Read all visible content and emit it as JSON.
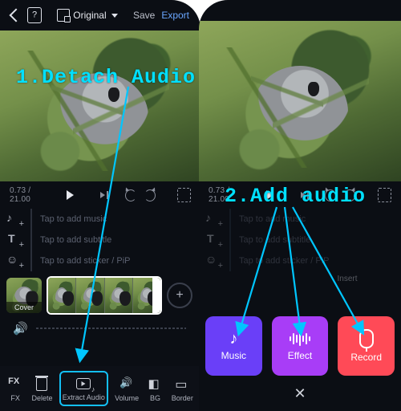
{
  "annotations": {
    "step1": "1.Detach Audio",
    "step2": "2.Add audio"
  },
  "toolbar": {
    "aspect_label": "Original",
    "save_label": "Save",
    "export_label": "Export"
  },
  "playback": {
    "time_display": "0.73 / 21.00"
  },
  "tracks": {
    "music_hint": "Tap to add music",
    "subtitle_hint": "Tap to add subtitle",
    "sticker_hint": "Tap to add sticker / PiP",
    "insert_label": "Insert"
  },
  "cover": {
    "label": "Cover"
  },
  "bottom_bar": {
    "items": [
      {
        "id": "fx",
        "label": "FX"
      },
      {
        "id": "delete",
        "label": "Delete"
      },
      {
        "id": "extract",
        "label": "Extract Audio"
      },
      {
        "id": "volume",
        "label": "Volume"
      },
      {
        "id": "bg",
        "label": "BG"
      },
      {
        "id": "border",
        "label": "Border"
      }
    ]
  },
  "audio_sheet": {
    "music_label": "Music",
    "effect_label": "Effect",
    "record_label": "Record"
  },
  "colors": {
    "highlight_box": "#13bff5",
    "music_btn": "#6a3ff8",
    "effect_btn": "#a83df7",
    "record_btn": "#ff4a57",
    "annotation": "#00c6ff"
  }
}
